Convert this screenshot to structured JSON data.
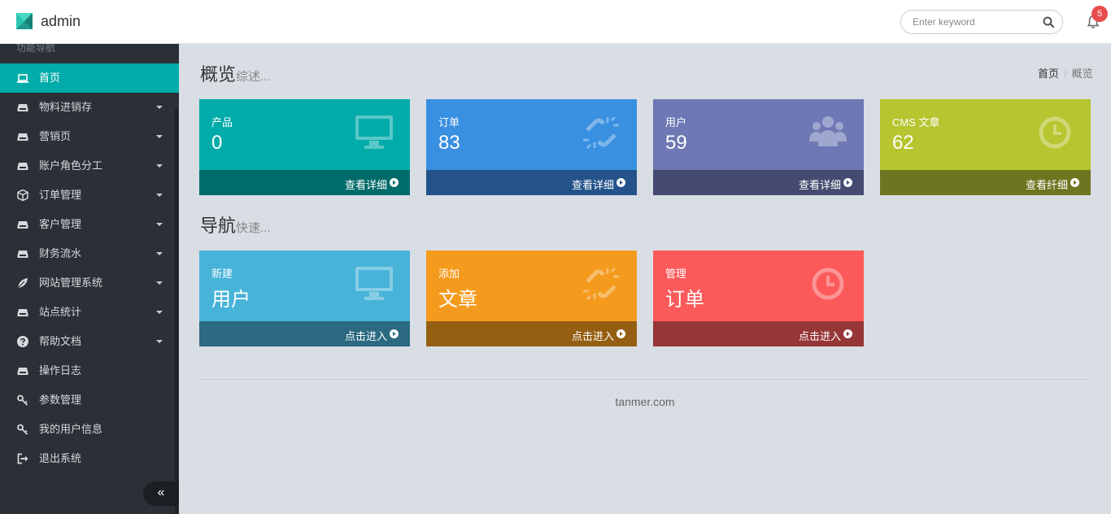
{
  "header": {
    "brand": "admin",
    "search_placeholder": "Enter keyword",
    "notification_count": "5"
  },
  "sidebar": {
    "title": "功能导航",
    "items": [
      {
        "label": "首页",
        "icon": "laptop-icon",
        "active": true,
        "has_submenu": false
      },
      {
        "label": "物料进销存",
        "icon": "inbox-icon",
        "has_submenu": true
      },
      {
        "label": "营销页",
        "icon": "inbox-icon",
        "has_submenu": true
      },
      {
        "label": "账户角色分工",
        "icon": "inbox-icon",
        "has_submenu": true
      },
      {
        "label": "订单管理",
        "icon": "cube-icon",
        "has_submenu": true
      },
      {
        "label": "客户管理",
        "icon": "inbox-icon",
        "has_submenu": true
      },
      {
        "label": "财务流水",
        "icon": "inbox-icon",
        "has_submenu": true
      },
      {
        "label": "网站管理系统",
        "icon": "leaf-icon",
        "has_submenu": true
      },
      {
        "label": "站点统计",
        "icon": "inbox-icon",
        "has_submenu": true
      },
      {
        "label": "帮助文档",
        "icon": "question-icon",
        "has_submenu": true
      },
      {
        "label": "操作日志",
        "icon": "inbox-icon",
        "has_submenu": false
      },
      {
        "label": "参数管理",
        "icon": "key-icon",
        "has_submenu": false
      },
      {
        "label": "我的用户信息",
        "icon": "key-icon",
        "has_submenu": false
      },
      {
        "label": "退出系统",
        "icon": "sign-out-icon",
        "has_submenu": false
      }
    ],
    "collapse_label": "«"
  },
  "overview": {
    "title": "概览",
    "subtitle": "综述...",
    "breadcrumb": {
      "home": "首页",
      "current": "概览"
    },
    "cards": [
      {
        "label": "产品",
        "value": "0",
        "link": "查看详细",
        "icon": "desktop-icon",
        "color": "#00aba9",
        "foot_color": "#006c6a"
      },
      {
        "label": "订单",
        "value": "83",
        "link": "查看详细",
        "icon": "chain-broken-icon",
        "color": "#398fe0",
        "foot_color": "#23538a"
      },
      {
        "label": "用户",
        "value": "59",
        "link": "查看详细",
        "icon": "users-icon",
        "color": "#6d78b4",
        "foot_color": "#444a70"
      },
      {
        "label": "CMS 文章",
        "value": "62",
        "link": "查看纤细",
        "icon": "clock-icon",
        "color": "#b6c530",
        "foot_color": "#6e7520"
      }
    ]
  },
  "quicknav": {
    "title": "导航",
    "subtitle": "快速...",
    "cards": [
      {
        "label": "新建",
        "value": "用户",
        "link": "点击进入",
        "icon": "desktop-icon",
        "color": "#47b3d8",
        "foot_color": "#2b6a80"
      },
      {
        "label": "添加",
        "value": "文章",
        "link": "点击进入",
        "icon": "chain-broken-icon",
        "color": "#f49a1d",
        "foot_color": "#955f12"
      },
      {
        "label": "管理",
        "value": "订单",
        "link": "点击进入",
        "icon": "clock-icon",
        "color": "#fc5a5a",
        "foot_color": "#973636"
      }
    ]
  },
  "footer": {
    "text": "tanmer.com"
  }
}
